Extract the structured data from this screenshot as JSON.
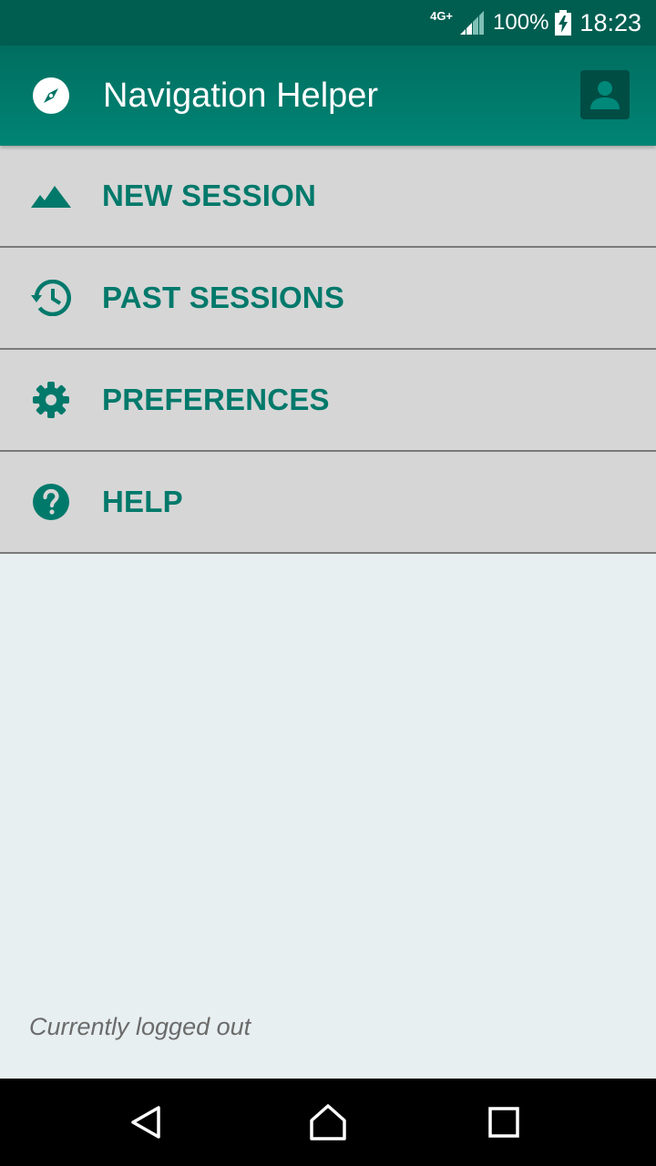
{
  "status_bar": {
    "network": "4G+",
    "battery": "100%",
    "time": "18:23"
  },
  "app_bar": {
    "title": "Navigation Helper",
    "app_icon": "compass-icon",
    "account_icon": "account-box-icon"
  },
  "menu": {
    "items": [
      {
        "label": "NEW SESSION",
        "icon": "landscape-icon"
      },
      {
        "label": "PAST SESSIONS",
        "icon": "history-icon"
      },
      {
        "label": "PREFERENCES",
        "icon": "gear-icon"
      },
      {
        "label": "HELP",
        "icon": "help-icon"
      }
    ]
  },
  "footer": {
    "login_status": "Currently logged out"
  },
  "nav_bar": {
    "back_icon": "back-icon",
    "home_icon": "home-icon",
    "recents_icon": "recents-icon"
  },
  "colors": {
    "primary": "#00796b",
    "primary_dark": "#005e51",
    "menu_bg": "#d6d6d6",
    "content_bg": "#e8eff1"
  }
}
